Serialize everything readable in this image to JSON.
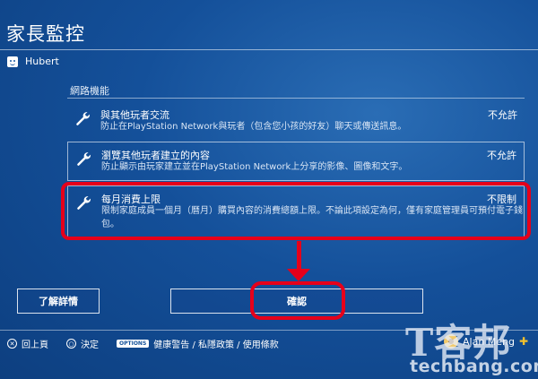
{
  "header": {
    "title": "家長監控",
    "user_name": "Hubert"
  },
  "section": {
    "label": "網路機能"
  },
  "settings": [
    {
      "name": "與其他玩者交流",
      "desc": "防止在PlayStation Network與玩者（包含您小孩的好友）聊天或傳送訊息。",
      "value": "不允許"
    },
    {
      "name": "瀏覽其他玩者建立的內容",
      "desc": "防止顯示由玩家建立並在PlayStation Network上分享的影像、圖像和文字。",
      "value": "不允許"
    },
    {
      "name": "每月消費上限",
      "desc": "限制家庭成員一個月（曆月）購買內容的消費總額上限。不論此項設定為何，僅有家庭管理員可預付電子錢包。",
      "value": "不限制"
    }
  ],
  "buttons": {
    "learn_more": "了解詳情",
    "confirm": "確認"
  },
  "footer": {
    "back_symbol": "✕",
    "back_label": "回上頁",
    "enter_symbol": "○",
    "enter_label": "決定",
    "options_key": "OPTIONS",
    "options_label": "健康警告 / 私隱政策 / 使用條款"
  },
  "account": {
    "name": "Alan Meng",
    "plus_symbol": "✚"
  },
  "watermark": {
    "brand": "T客邦",
    "site": "techbang.com"
  },
  "colors": {
    "background": "#14509a",
    "highlight": "#e6001a",
    "plus": "#f3c12d"
  },
  "icons": [
    "user-face-icon",
    "wrench-icon",
    "cross-button-icon",
    "circle-button-icon",
    "options-button-icon",
    "avatar-icon",
    "ps-plus-icon"
  ]
}
